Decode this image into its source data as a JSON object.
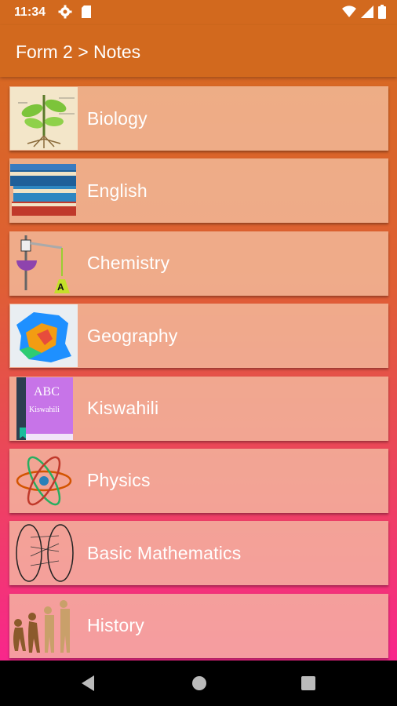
{
  "status": {
    "time": "11:34"
  },
  "appbar": {
    "title": "Form 2 > Notes"
  },
  "subjects": [
    {
      "label": "Biology",
      "icon": "plant-diagram-icon"
    },
    {
      "label": "English",
      "icon": "books-stack-icon"
    },
    {
      "label": "Chemistry",
      "icon": "chemistry-apparatus-icon"
    },
    {
      "label": "Geography",
      "icon": "map-icon"
    },
    {
      "label": "Kiswahili",
      "icon": "book-icon",
      "book_title": "ABC",
      "book_subtitle": "Kiswahili"
    },
    {
      "label": "Physics",
      "icon": "atom-icon"
    },
    {
      "label": "Basic Mathematics",
      "icon": "sets-mapping-icon"
    },
    {
      "label": "History",
      "icon": "human-evolution-icon"
    }
  ],
  "colors": {
    "appbar": "#d2691e",
    "gradient_top": "#d56b1e",
    "gradient_bottom": "#fb1f97"
  }
}
